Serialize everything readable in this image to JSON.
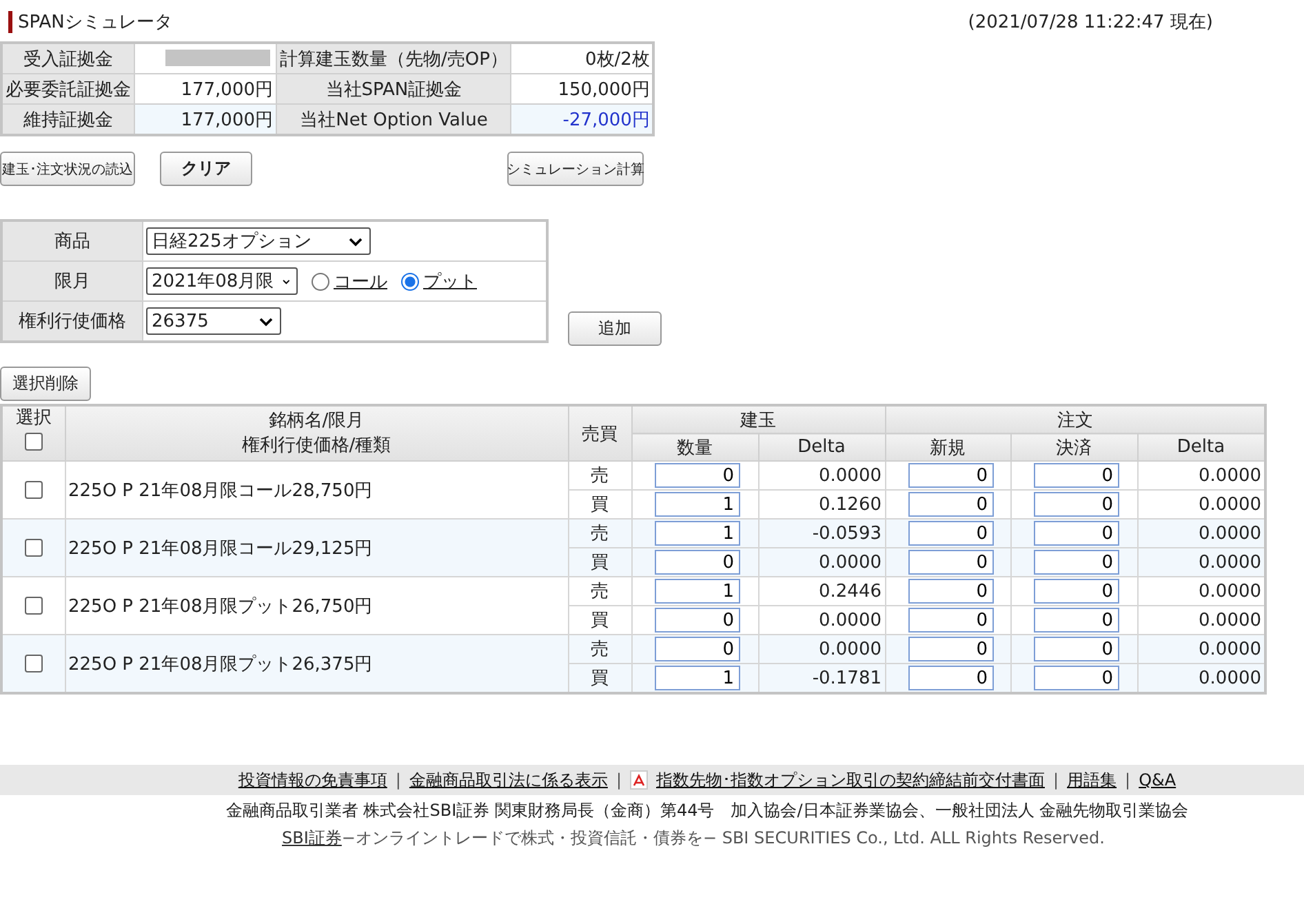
{
  "title": "SPANシミュレータ",
  "timestamp": "(2021/07/28 11:22:47 現在)",
  "summary": [
    {
      "label": "受入証拠金",
      "redacted": true,
      "label2": "計算建玉数量（先物/売OP）",
      "value2": "0枚/2枚",
      "negative2": false
    },
    {
      "label": "必要委託証拠金",
      "value": "177,000円",
      "label2": "当社SPAN証拠金",
      "value2": "150,000円",
      "negative2": false
    },
    {
      "label": "維持証拠金",
      "value": "177,000円",
      "label2": "当社Net Option Value",
      "value2": "-27,000円",
      "negative2": true
    }
  ],
  "buttons": [
    "建玉･注文状況の読込",
    "クリア",
    "シミュレーション計算"
  ],
  "form": {
    "product_label": "商品",
    "product": "日経225オプション",
    "month_label": "限月",
    "month": "2021年08月限",
    "radios": [
      {
        "label": "コール",
        "selected": false
      },
      {
        "label": "プット",
        "selected": true
      }
    ],
    "strike_label": "権利行使価格",
    "strike": "26375",
    "add_button": "追加"
  },
  "delete_button": "選択削除",
  "table": {
    "select_header": "選択",
    "select_all_checked": false,
    "name_header": [
      "銘柄名/限月",
      "権利行使価格/種類"
    ],
    "side_header": "売買",
    "groups": [
      {
        "label": "建玉",
        "columns": [
          "数量",
          "Delta"
        ]
      },
      {
        "label": "注文",
        "columns": [
          "新規",
          "決済",
          "Delta"
        ]
      }
    ],
    "rows": [
      {
        "name": "225O P 21年08月限コール28,750円",
        "checked": false,
        "legs": [
          {
            "side": "売",
            "qty": "0",
            "delta": "0.0000",
            "new": "0",
            "close": "0",
            "order_delta": "0.0000"
          },
          {
            "side": "買",
            "qty": "1",
            "delta": "0.1260",
            "new": "0",
            "close": "0",
            "order_delta": "0.0000"
          }
        ]
      },
      {
        "name": "225O P 21年08月限コール29,125円",
        "checked": false,
        "legs": [
          {
            "side": "売",
            "qty": "1",
            "delta": "-0.0593",
            "new": "0",
            "close": "0",
            "order_delta": "0.0000"
          },
          {
            "side": "買",
            "qty": "0",
            "delta": "0.0000",
            "new": "0",
            "close": "0",
            "order_delta": "0.0000"
          }
        ]
      },
      {
        "name": "225O P 21年08月限プット26,750円",
        "checked": false,
        "legs": [
          {
            "side": "売",
            "qty": "1",
            "delta": "0.2446",
            "new": "0",
            "close": "0",
            "order_delta": "0.0000"
          },
          {
            "side": "買",
            "qty": "0",
            "delta": "0.0000",
            "new": "0",
            "close": "0",
            "order_delta": "0.0000"
          }
        ]
      },
      {
        "name": "225O P 21年08月限プット26,375円",
        "checked": false,
        "legs": [
          {
            "side": "売",
            "qty": "0",
            "delta": "0.0000",
            "new": "0",
            "close": "0",
            "order_delta": "0.0000"
          },
          {
            "side": "買",
            "qty": "1",
            "delta": "-0.1781",
            "new": "0",
            "close": "0",
            "order_delta": "0.0000"
          }
        ]
      }
    ]
  },
  "footer": {
    "separator": "|",
    "links": [
      {
        "text": "投資情報の免責事項",
        "kind": "plain"
      },
      {
        "text": "金融商品取引法に係る表示",
        "kind": "plain"
      },
      {
        "text": "指数先物･指数オプション取引の契約締結前交付書面",
        "kind": "pdf"
      },
      {
        "text": "用語集",
        "kind": "plain"
      },
      {
        "text": "Q&A",
        "kind": "plain"
      }
    ],
    "registration": "金融商品取引業者 株式会社SBI証券 関東財務局長（金商）第44号　加入協会/日本証券業協会、一般社団法人 金融先物取引業協会",
    "brand_link": "SBI証券",
    "copyright": "−オンライントレードで株式・投資信託・債券を− SBI SECURITIES Co., Ltd. ALL Rights Reserved."
  }
}
